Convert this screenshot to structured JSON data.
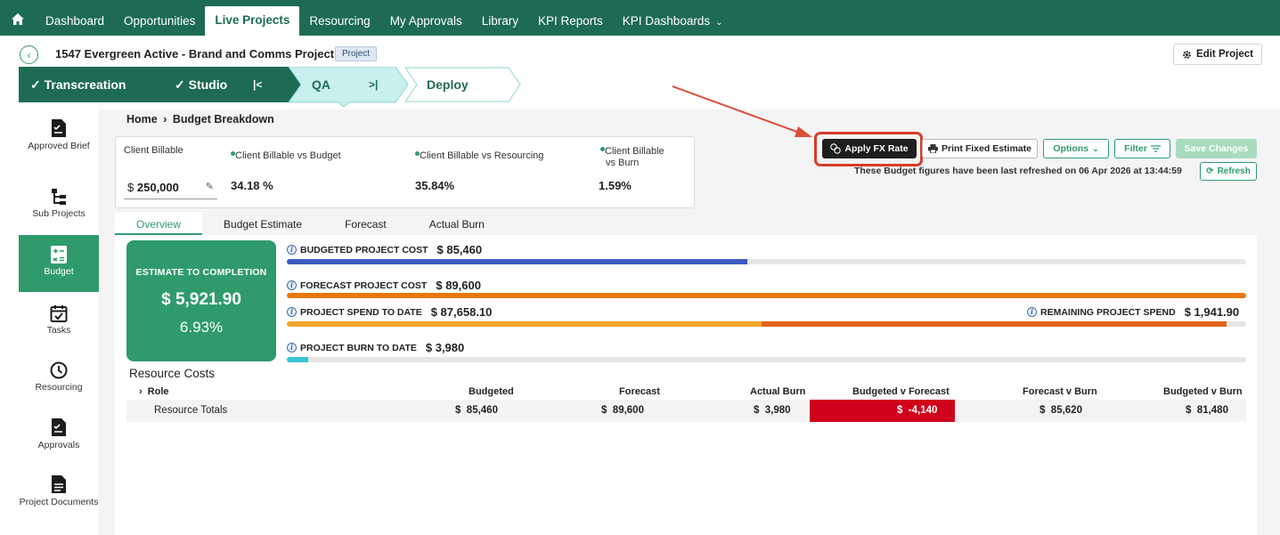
{
  "nav": {
    "items": [
      {
        "label": "Dashboard"
      },
      {
        "label": "Opportunities"
      },
      {
        "label": "Live Projects",
        "active": true
      },
      {
        "label": "Resourcing"
      },
      {
        "label": "My Approvals"
      },
      {
        "label": "Library"
      },
      {
        "label": "KPI Reports"
      },
      {
        "label": "KPI Dashboards"
      }
    ]
  },
  "project": {
    "title": "1547 Evergreen Active - Brand and Comms Project",
    "badge": "Project",
    "edit_label": "Edit Project"
  },
  "stepper": [
    {
      "label": "Transcreation",
      "state": "done"
    },
    {
      "label": "Studio",
      "state": "done"
    },
    {
      "label": "QA",
      "state": "current"
    },
    {
      "label": "Deploy",
      "state": "todo"
    }
  ],
  "sidebar": {
    "items": [
      {
        "label": "Approved Brief"
      },
      {
        "label": "Sub Projects"
      },
      {
        "label": "Budget",
        "active": true
      },
      {
        "label": "Tasks"
      },
      {
        "label": "Resourcing"
      },
      {
        "label": "Approvals"
      },
      {
        "label": "Project Documents"
      }
    ]
  },
  "breadcrumb": {
    "home": "Home",
    "current": "Budget Breakdown"
  },
  "kpis": {
    "billable_label": "Client Billable",
    "billable_currency": "$",
    "billable_value": "250,000",
    "vs_budget_label": "Client Billable vs Budget",
    "vs_budget_value": "34.18 %",
    "vs_resourcing_label": "Client Billable vs Resourcing",
    "vs_resourcing_value": "35.84%",
    "vs_burn_label_1": "Client Billable",
    "vs_burn_label_2": "vs Burn",
    "vs_burn_value": "1.59%"
  },
  "actions": {
    "fx_label": "Apply FX Rate",
    "print_label": "Print Fixed Estimate",
    "options_label": "Options",
    "filter_label": "Filter",
    "save_label": "Save Changes",
    "refresh_note": "These Budget figures have been last refreshed on 06 Apr 2026 at 13:44:59",
    "refresh_label": "Refresh"
  },
  "tabs": [
    {
      "label": "Overview",
      "active": true
    },
    {
      "label": "Budget Estimate"
    },
    {
      "label": "Forecast"
    },
    {
      "label": "Actual Burn"
    }
  ],
  "etc": {
    "title": "ESTIMATE TO COMPLETION",
    "amount": "$ 5,921.90",
    "percent": "6.93%"
  },
  "bars": {
    "budgeted": {
      "label": "BUDGETED PROJECT COST",
      "amount": "$ 85,460",
      "fill": 0.48,
      "color": "#3a5bbf"
    },
    "forecast": {
      "label": "FORECAST PROJECT COST",
      "amount": "$ 89,600",
      "fill": 1.0,
      "color": "#e8770d"
    },
    "spend": {
      "label": "PROJECT SPEND TO DATE",
      "amount": "$ 87,658.10",
      "fill": 0.98,
      "split": 0.495,
      "color_a": "#f0a52a",
      "color_b": "#e0641a"
    },
    "remaining": {
      "label": "REMAINING PROJECT SPEND",
      "amount": "$ 1,941.90"
    },
    "burn": {
      "label": "PROJECT BURN TO DATE",
      "amount": "$ 3,980",
      "fill": 0.022,
      "color": "#36c4d3"
    }
  },
  "resources": {
    "title": "Resource Costs",
    "headers": {
      "role": "Role",
      "budgeted": "Budgeted",
      "forecast": "Forecast",
      "actual": "Actual Burn",
      "bvf": "Budgeted v Forecast",
      "fvb": "Forecast v Burn",
      "bvb": "Budgeted v Burn"
    },
    "totals": {
      "label": "Resource Totals",
      "budgeted": "85,460",
      "forecast": "89,600",
      "actual": "3,980",
      "bvf": "-4,140",
      "fvb": "85,620",
      "bvb": "81,480"
    }
  },
  "colors": {
    "brand": "#1e6b55",
    "accent": "#2f9b6d",
    "negative": "#d0021b",
    "highlight": "#d73c2c"
  }
}
